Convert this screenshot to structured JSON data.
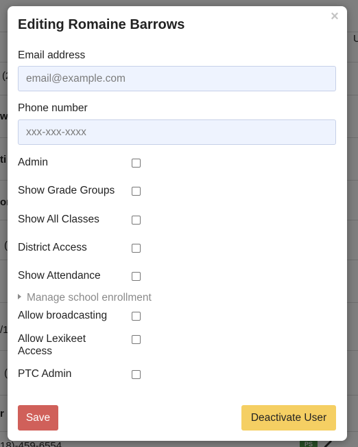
{
  "background": {
    "fragments": [
      {
        "id": "f1",
        "text": "(2"
      },
      {
        "id": "f2",
        "text": "w"
      },
      {
        "id": "f3",
        "text": "ti"
      },
      {
        "id": "f4",
        "text": "on"
      },
      {
        "id": "f5",
        "text": "("
      },
      {
        "id": "f6",
        "text": "/1"
      },
      {
        "id": "f7",
        "text": "("
      },
      {
        "id": "f8",
        "text": "r"
      },
      {
        "id": "f9",
        "text": "18)-459-6554"
      },
      {
        "id": "f10",
        "text": "U"
      }
    ],
    "badge": "PS"
  },
  "modal": {
    "title": "Editing Romaine Barrows",
    "close_symbol": "×",
    "email": {
      "label": "Email address",
      "placeholder": "email@example.com",
      "value": ""
    },
    "phone": {
      "label": "Phone number",
      "placeholder": "xxx-xxx-xxxx",
      "value": ""
    },
    "permissions": [
      {
        "label": "Admin",
        "checked": false
      },
      {
        "label": "Show Grade Groups",
        "checked": false
      },
      {
        "label": "Show All Classes",
        "checked": false
      },
      {
        "label": "District Access",
        "checked": false
      },
      {
        "label": "Show Attendance",
        "checked": false
      }
    ],
    "enrollment_toggle": "Manage school enrollment",
    "extra_permissions": [
      {
        "label": "Allow broadcasting",
        "checked": false
      },
      {
        "label": "Allow Lexikeet Access",
        "checked": false
      },
      {
        "label": "PTC Admin",
        "checked": false
      }
    ],
    "save_label": "Save",
    "deactivate_label": "Deactivate User"
  }
}
